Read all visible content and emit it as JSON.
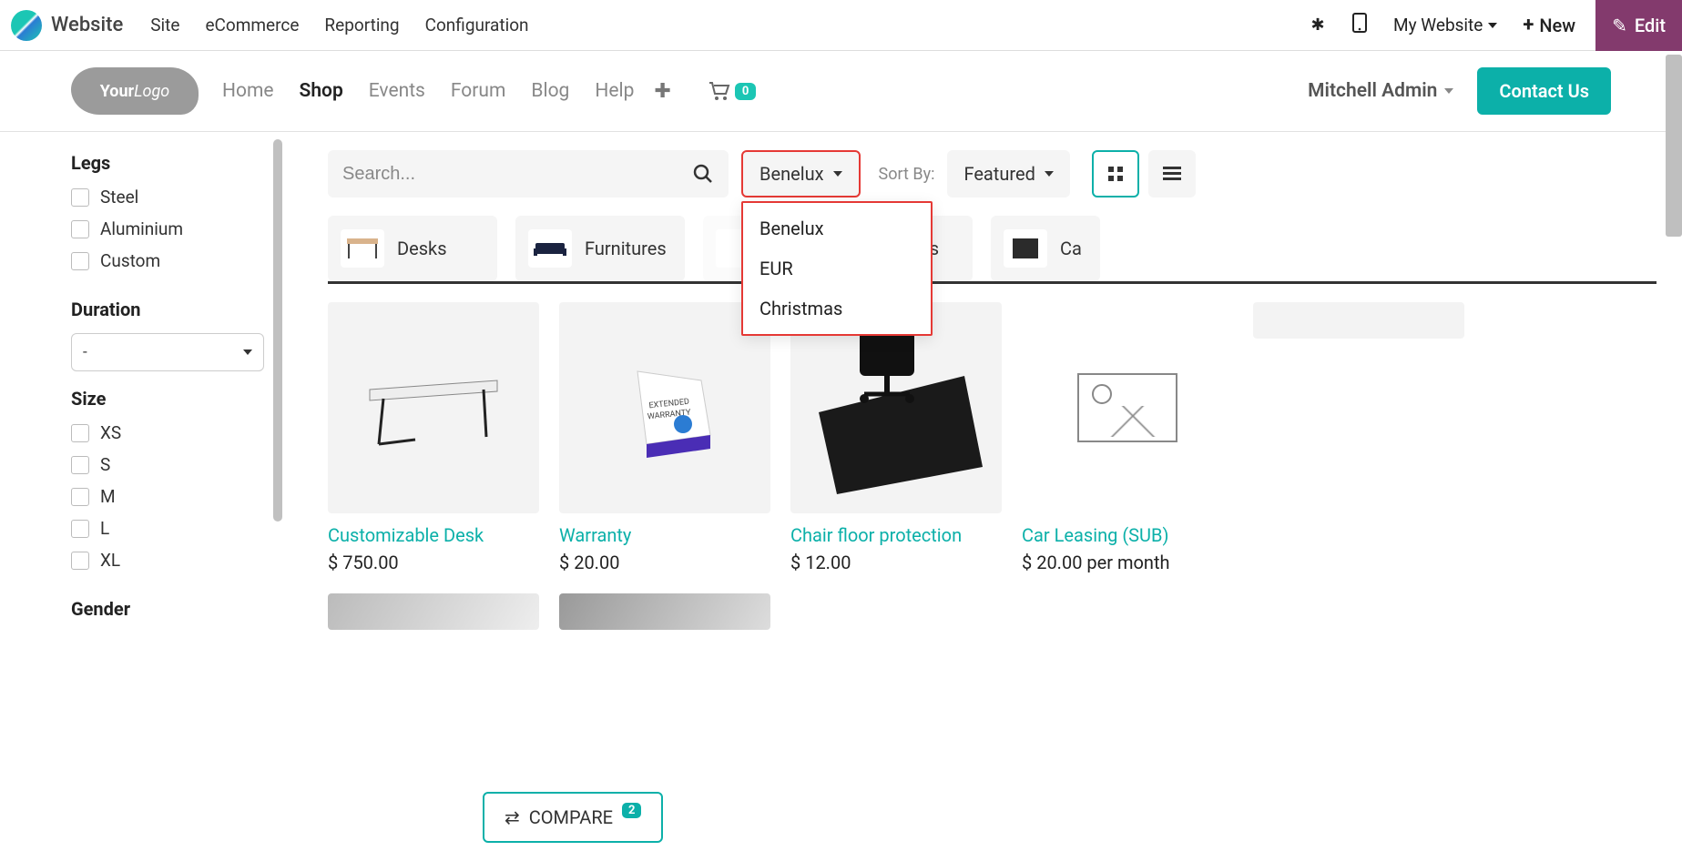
{
  "admin": {
    "brand": "Website",
    "menu": [
      "Site",
      "eCommerce",
      "Reporting",
      "Configuration"
    ],
    "my_website": "My Website",
    "new": "New",
    "edit": "Edit"
  },
  "site_header": {
    "logo_text": "YourLogo",
    "nav": [
      {
        "label": "Home",
        "active": false
      },
      {
        "label": "Shop",
        "active": true
      },
      {
        "label": "Events",
        "active": false
      },
      {
        "label": "Forum",
        "active": false
      },
      {
        "label": "Blog",
        "active": false
      },
      {
        "label": "Help",
        "active": false
      }
    ],
    "cart_count": "0",
    "user": "Mitchell Admin",
    "contact": "Contact Us"
  },
  "sidebar": {
    "legs": {
      "title": "Legs",
      "options": [
        "Steel",
        "Aluminium",
        "Custom"
      ]
    },
    "duration": {
      "title": "Duration",
      "value": "-"
    },
    "size": {
      "title": "Size",
      "options": [
        "XS",
        "S",
        "M",
        "L",
        "XL"
      ]
    },
    "gender": {
      "title": "Gender"
    }
  },
  "toolbar": {
    "search_placeholder": "Search...",
    "pricelist": {
      "selected": "Benelux",
      "options": [
        "Benelux",
        "EUR",
        "Christmas"
      ]
    },
    "sort_label": "Sort By:",
    "sort_value": "Featured"
  },
  "categories": [
    {
      "label": "Desks"
    },
    {
      "label": "Furnitures"
    },
    {
      "label": ""
    },
    {
      "label": "Drawers"
    },
    {
      "label": "Ca"
    }
  ],
  "products": [
    {
      "name": "Customizable Desk",
      "price": "$ 750.00"
    },
    {
      "name": "Warranty",
      "price": "$ 20.00"
    },
    {
      "name": "Chair floor protection",
      "price": "$ 12.00"
    },
    {
      "name": "Car Leasing (SUB)",
      "price": "$ 20.00 per month"
    }
  ],
  "compare": {
    "label": "COMPARE",
    "count": "2"
  }
}
